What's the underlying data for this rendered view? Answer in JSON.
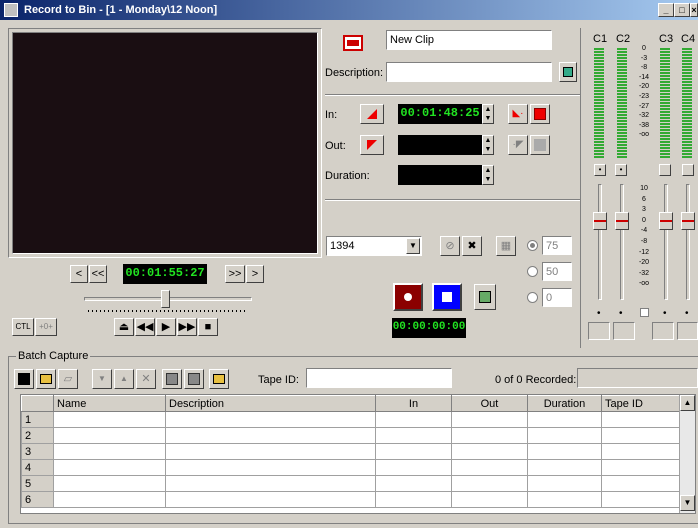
{
  "window": {
    "title": "Record to Bin - [1 - Monday\\12 Noon]"
  },
  "clip": {
    "name": "New Clip",
    "description_label": "Description:",
    "description_value": ""
  },
  "timecodes": {
    "in_label": "In:",
    "in_value": "00:01:48:25",
    "out_label": "Out:",
    "out_value": "",
    "duration_label": "Duration:",
    "duration_value": "",
    "player_position": "00:01:55:27",
    "record_counter": "00:00:00:00"
  },
  "transport": {
    "step_back_one": "<",
    "step_back_ten": "<<",
    "step_fwd_ten": ">>",
    "step_fwd_one": ">",
    "ctl_label": "CTL",
    "ctl2_label": "+0+"
  },
  "device": {
    "selected": "1394"
  },
  "radios": [
    {
      "value": "75",
      "selected": true
    },
    {
      "value": "50",
      "selected": false
    },
    {
      "value": "0",
      "selected": false
    }
  ],
  "audio": {
    "channels": [
      "C1",
      "C2",
      "C3",
      "C4"
    ],
    "scale_top": [
      "0",
      "-3",
      "-8",
      "-14",
      "-20",
      "-23",
      "-27",
      "-32",
      "-38",
      "-oo"
    ],
    "scale_bottom": [
      "10",
      "6",
      "3",
      "0",
      "-4",
      "-8",
      "-12",
      "-20",
      "-32",
      "-oo"
    ]
  },
  "batch": {
    "group_label": "Batch Capture",
    "tape_id_label": "Tape ID:",
    "tape_id_value": "",
    "recorded_status": "0 of 0 Recorded:",
    "columns": [
      "Name",
      "Description",
      "In",
      "Out",
      "Duration",
      "Tape ID"
    ],
    "rows": [
      "1",
      "2",
      "3",
      "4",
      "5",
      "6"
    ]
  },
  "colors": {
    "titlebar": "#0a246a",
    "timecode_green": "#21e321",
    "record_red": "#8b0000",
    "stop_blue": "#0000ff"
  }
}
